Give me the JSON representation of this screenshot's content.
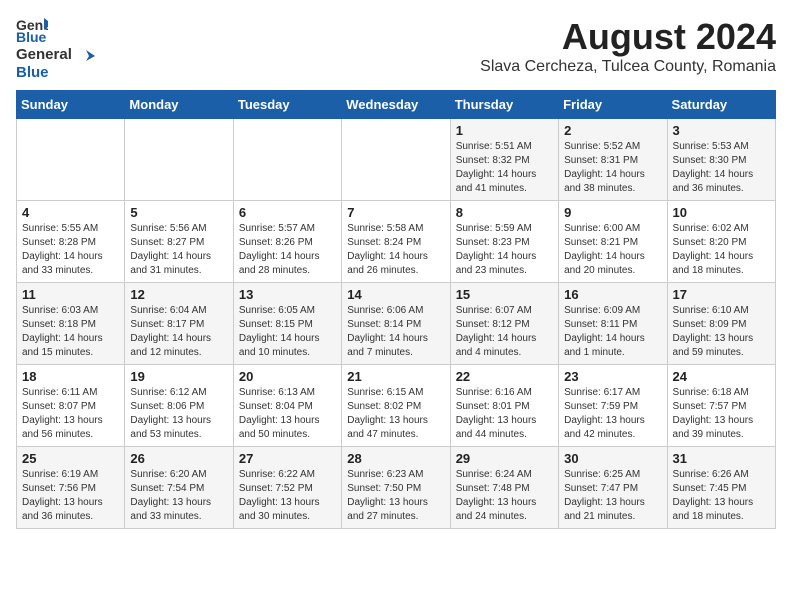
{
  "header": {
    "logo_line1": "General",
    "logo_line2": "Blue",
    "title": "August 2024",
    "subtitle": "Slava Cercheza, Tulcea County, Romania"
  },
  "weekdays": [
    "Sunday",
    "Monday",
    "Tuesday",
    "Wednesday",
    "Thursday",
    "Friday",
    "Saturday"
  ],
  "weeks": [
    [
      {
        "day": "",
        "info": ""
      },
      {
        "day": "",
        "info": ""
      },
      {
        "day": "",
        "info": ""
      },
      {
        "day": "",
        "info": ""
      },
      {
        "day": "1",
        "info": "Sunrise: 5:51 AM\nSunset: 8:32 PM\nDaylight: 14 hours\nand 41 minutes."
      },
      {
        "day": "2",
        "info": "Sunrise: 5:52 AM\nSunset: 8:31 PM\nDaylight: 14 hours\nand 38 minutes."
      },
      {
        "day": "3",
        "info": "Sunrise: 5:53 AM\nSunset: 8:30 PM\nDaylight: 14 hours\nand 36 minutes."
      }
    ],
    [
      {
        "day": "4",
        "info": "Sunrise: 5:55 AM\nSunset: 8:28 PM\nDaylight: 14 hours\nand 33 minutes."
      },
      {
        "day": "5",
        "info": "Sunrise: 5:56 AM\nSunset: 8:27 PM\nDaylight: 14 hours\nand 31 minutes."
      },
      {
        "day": "6",
        "info": "Sunrise: 5:57 AM\nSunset: 8:26 PM\nDaylight: 14 hours\nand 28 minutes."
      },
      {
        "day": "7",
        "info": "Sunrise: 5:58 AM\nSunset: 8:24 PM\nDaylight: 14 hours\nand 26 minutes."
      },
      {
        "day": "8",
        "info": "Sunrise: 5:59 AM\nSunset: 8:23 PM\nDaylight: 14 hours\nand 23 minutes."
      },
      {
        "day": "9",
        "info": "Sunrise: 6:00 AM\nSunset: 8:21 PM\nDaylight: 14 hours\nand 20 minutes."
      },
      {
        "day": "10",
        "info": "Sunrise: 6:02 AM\nSunset: 8:20 PM\nDaylight: 14 hours\nand 18 minutes."
      }
    ],
    [
      {
        "day": "11",
        "info": "Sunrise: 6:03 AM\nSunset: 8:18 PM\nDaylight: 14 hours\nand 15 minutes."
      },
      {
        "day": "12",
        "info": "Sunrise: 6:04 AM\nSunset: 8:17 PM\nDaylight: 14 hours\nand 12 minutes."
      },
      {
        "day": "13",
        "info": "Sunrise: 6:05 AM\nSunset: 8:15 PM\nDaylight: 14 hours\nand 10 minutes."
      },
      {
        "day": "14",
        "info": "Sunrise: 6:06 AM\nSunset: 8:14 PM\nDaylight: 14 hours\nand 7 minutes."
      },
      {
        "day": "15",
        "info": "Sunrise: 6:07 AM\nSunset: 8:12 PM\nDaylight: 14 hours\nand 4 minutes."
      },
      {
        "day": "16",
        "info": "Sunrise: 6:09 AM\nSunset: 8:11 PM\nDaylight: 14 hours\nand 1 minute."
      },
      {
        "day": "17",
        "info": "Sunrise: 6:10 AM\nSunset: 8:09 PM\nDaylight: 13 hours\nand 59 minutes."
      }
    ],
    [
      {
        "day": "18",
        "info": "Sunrise: 6:11 AM\nSunset: 8:07 PM\nDaylight: 13 hours\nand 56 minutes."
      },
      {
        "day": "19",
        "info": "Sunrise: 6:12 AM\nSunset: 8:06 PM\nDaylight: 13 hours\nand 53 minutes."
      },
      {
        "day": "20",
        "info": "Sunrise: 6:13 AM\nSunset: 8:04 PM\nDaylight: 13 hours\nand 50 minutes."
      },
      {
        "day": "21",
        "info": "Sunrise: 6:15 AM\nSunset: 8:02 PM\nDaylight: 13 hours\nand 47 minutes."
      },
      {
        "day": "22",
        "info": "Sunrise: 6:16 AM\nSunset: 8:01 PM\nDaylight: 13 hours\nand 44 minutes."
      },
      {
        "day": "23",
        "info": "Sunrise: 6:17 AM\nSunset: 7:59 PM\nDaylight: 13 hours\nand 42 minutes."
      },
      {
        "day": "24",
        "info": "Sunrise: 6:18 AM\nSunset: 7:57 PM\nDaylight: 13 hours\nand 39 minutes."
      }
    ],
    [
      {
        "day": "25",
        "info": "Sunrise: 6:19 AM\nSunset: 7:56 PM\nDaylight: 13 hours\nand 36 minutes."
      },
      {
        "day": "26",
        "info": "Sunrise: 6:20 AM\nSunset: 7:54 PM\nDaylight: 13 hours\nand 33 minutes."
      },
      {
        "day": "27",
        "info": "Sunrise: 6:22 AM\nSunset: 7:52 PM\nDaylight: 13 hours\nand 30 minutes."
      },
      {
        "day": "28",
        "info": "Sunrise: 6:23 AM\nSunset: 7:50 PM\nDaylight: 13 hours\nand 27 minutes."
      },
      {
        "day": "29",
        "info": "Sunrise: 6:24 AM\nSunset: 7:48 PM\nDaylight: 13 hours\nand 24 minutes."
      },
      {
        "day": "30",
        "info": "Sunrise: 6:25 AM\nSunset: 7:47 PM\nDaylight: 13 hours\nand 21 minutes."
      },
      {
        "day": "31",
        "info": "Sunrise: 6:26 AM\nSunset: 7:45 PM\nDaylight: 13 hours\nand 18 minutes."
      }
    ]
  ]
}
